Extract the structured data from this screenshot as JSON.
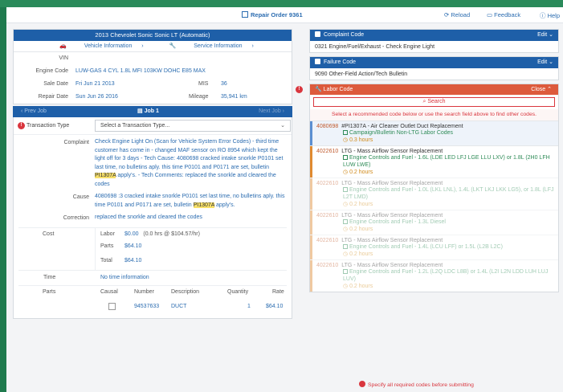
{
  "topbar": {
    "repair_order": "Repair Order 9361",
    "reload": "Reload",
    "feedback": "Feedback",
    "help": "Help"
  },
  "vehicle": {
    "title": "2013 Chevrolet Sonic Sonic LT (Automatic)",
    "tab_vehicle": "Vehicle Information",
    "tab_service": "Service Information",
    "vin_label": "VIN",
    "vin_value": "",
    "engine_label": "Engine Code",
    "engine_value": "LUW-GAS 4 CYL 1.8L MFI 103KW DOHC E85 MAX",
    "sale_label": "Sale Date",
    "sale_value": "Fri Jun 21 2013",
    "mis_label": "MIS",
    "mis_value": "36",
    "repair_label": "Repair Date",
    "repair_value": "Sun Jun 26 2016",
    "mileage_label": "Mileage",
    "mileage_value": "35,941 km"
  },
  "jobnav": {
    "prev": "Prev Job",
    "job": "Job 1",
    "next": "Next Job"
  },
  "job": {
    "tx_label": "Transaction Type",
    "tx_placeholder": "Select a Transaction Type...",
    "complaint_label": "Complaint",
    "complaint_pre": "Check Engine Light On (Scan for Vehicle System Error Codes) - third time customer has come in - changed MAF sensor on RO 8954 which kept the light off for 3 days - Tech Cause: 4080698 cracked intake snorkle P0101 set last time, no bulletins aply. this time P0101 and P0171 are set, bulletin ",
    "complaint_hl": "PI1307A",
    "complaint_post": " apply's. - Tech Comments: replaced the snorkle and cleared the codes",
    "cause_label": "Cause",
    "cause_pre": "4080698 :3 cracked intake snorkle P0101 set last time, no bulletins aply. this time P0101 and P0171 are set, bulletin ",
    "cause_hl": "PI1307A",
    "cause_post": " apply's.",
    "correction_label": "Correction",
    "correction_value": "replaced the snorkle and cleared the codes",
    "cost_label": "Cost",
    "labor_label": "Labor",
    "labor_value": "$0.00",
    "labor_detail": "(0.0 hrs @ $104.57/hr)",
    "parts_label": "Parts",
    "parts_value": "$64.10",
    "total_label": "Total",
    "total_value": "$64.10",
    "time_label": "Time",
    "time_value": "No time information",
    "parts_section_label": "Parts",
    "parts_headers": [
      "Causal",
      "Number",
      "Description",
      "Quantity",
      "Rate"
    ],
    "parts_row": {
      "number": "94537633",
      "description": "DUCT",
      "quantity": "1",
      "rate": "$64.10"
    }
  },
  "complaint_code": {
    "title": "Complaint Code",
    "edit": "Edit",
    "value": "0321  Engine/Fuel/Exhaust - Check Engine Light"
  },
  "failure_code": {
    "title": "Failure Code",
    "edit": "Edit",
    "value": "9090  Other-Field Action/Tech Bulletin"
  },
  "labor_code": {
    "title": "Labor Code",
    "close": "Close",
    "search": "Search",
    "hint": "Select a recommended code below or use the search field above to find other codes.",
    "items": [
      {
        "code": "4080698",
        "name": "#PI1307A - Air Cleaner Outlet Duct Replacement",
        "tag": "Campaign/Bulletin Non-LTG Labor Codes",
        "hours": "0.3 hours"
      },
      {
        "code": "4022610",
        "name": "LTG - Mass Airflow Sensor Replacement",
        "tag": "Engine Controls and Fuel - 1.6L (LDE LED LFJ LGE LLU LXV) or 1.8L (2H0 LFH LUW LWE)",
        "hours": "0.2 hours"
      },
      {
        "code": "4022610",
        "name": "LTG - Mass Airflow Sensor Replacement",
        "tag": "Engine Controls and Fuel - 1.0L (LKL LNL), 1.4L (LKT LKJ LKK LG5), or 1.8L (LFJ L2T LMD)",
        "hours": "0.2 hours"
      },
      {
        "code": "4022610",
        "name": "LTG - Mass Airflow Sensor Replacement",
        "tag": "Engine Controls and Fuel - 1.3L Diesel",
        "hours": "0.2 hours"
      },
      {
        "code": "4022610",
        "name": "LTG - Mass Airflow Sensor Replacement",
        "tag": "Engine Controls and Fuel - 1.4L (LCU LFF) or 1.5L (L2B L2C)",
        "hours": "0.2 hours"
      },
      {
        "code": "4022610",
        "name": "LTG - Mass Airflow Sensor Replacement",
        "tag": "Engine Controls and Fuel - 1.2L (L2Q LDC L8B) or 1.4L (L2I L2N LDD LUH LUJ LUV)",
        "hours": "0.2 hours"
      }
    ]
  },
  "bottom_warning": "Specify all required codes before submitting",
  "colors": {
    "brand_blue": "#1e5fa8",
    "labor_red": "#dd5a3c",
    "link_blue": "#2b6cb0",
    "frame_green": "#1f7a4e"
  }
}
